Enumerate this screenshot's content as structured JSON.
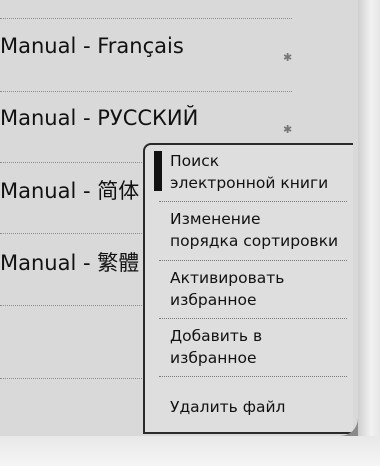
{
  "book_list": {
    "items": [
      {
        "title": "Manual - Français"
      },
      {
        "title": "Manual - РУССКИЙ"
      },
      {
        "title": "Manual - 简体"
      },
      {
        "title": "Manual - 繁體"
      }
    ]
  },
  "context_menu": {
    "items": [
      {
        "line1": "Поиск",
        "line2": "электронной книги"
      },
      {
        "line1": "Изменение",
        "line2": "порядка сортировки"
      },
      {
        "line1": "Активировать",
        "line2": "избранное"
      },
      {
        "line1": "Добавить в",
        "line2": "избранное"
      },
      {
        "line1": "Удалить файл",
        "line2": ""
      }
    ]
  }
}
